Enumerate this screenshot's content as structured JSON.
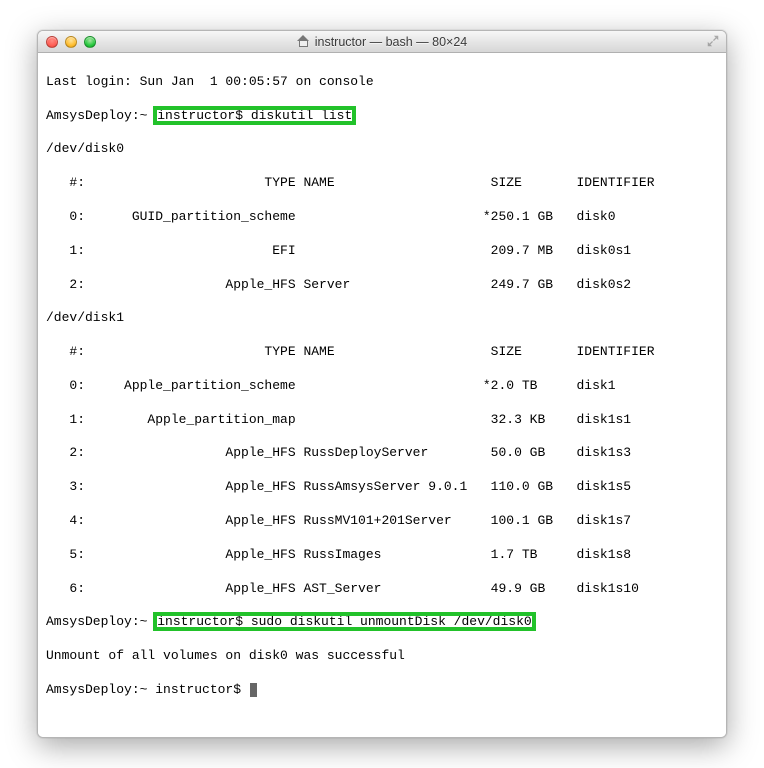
{
  "window": {
    "title": "instructor — bash — 80×24"
  },
  "terminal": {
    "login_line": "Last login: Sun Jan  1 00:05:57 on console",
    "prompt1_host": "AmsysDeploy:~ ",
    "prompt1_user_cmd": "instructor$ diskutil list",
    "disk0_header": "/dev/disk0",
    "cols": "   #:                       TYPE NAME                    SIZE       IDENTIFIER",
    "d0_r0": "   0:      GUID_partition_scheme                        *250.1 GB   disk0",
    "d0_r1": "   1:                        EFI                         209.7 MB   disk0s1",
    "d0_r2": "   2:                  Apple_HFS Server                  249.7 GB   disk0s2",
    "disk1_header": "/dev/disk1",
    "d1_r0": "   0:     Apple_partition_scheme                        *2.0 TB     disk1",
    "d1_r1": "   1:        Apple_partition_map                         32.3 KB    disk1s1",
    "d1_r2": "   2:                  Apple_HFS RussDeployServer        50.0 GB    disk1s3",
    "d1_r3": "   3:                  Apple_HFS RussAmsysServer 9.0.1   110.0 GB   disk1s5",
    "d1_r4": "   4:                  Apple_HFS RussMV101+201Server     100.1 GB   disk1s7",
    "d1_r5": "   5:                  Apple_HFS RussImages              1.7 TB     disk1s8",
    "d1_r6": "   6:                  Apple_HFS AST_Server              49.9 GB    disk1s10",
    "prompt2_host": "AmsysDeploy:~ ",
    "prompt2_user_cmd": "instructor$ sudo diskutil unmountDisk /dev/disk0",
    "result": "Unmount of all volumes on disk0 was successful",
    "prompt3": "AmsysDeploy:~ instructor$ "
  },
  "highlight_color": "#22c22a"
}
